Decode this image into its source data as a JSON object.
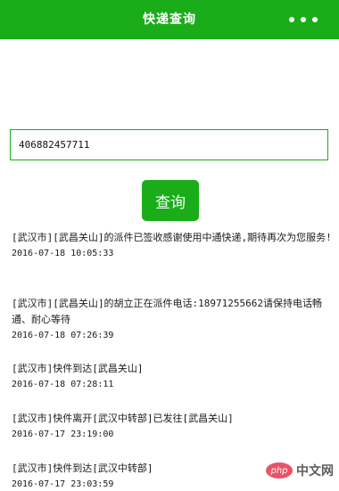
{
  "header": {
    "title": "快递查询",
    "menu_icon": "more-dots-icon",
    "color": "#1aad19"
  },
  "search": {
    "value": "406882457711"
  },
  "query_button": {
    "label": "查询"
  },
  "results": [
    {
      "message": "[武汉市][武昌关山]的派件已签收感谢使用中通快递,期待再次为您服务!",
      "time": "2016-07-18 10:05:33"
    },
    {
      "message": "[武汉市][武昌关山]的胡立正在派件电话:18971255662请保持电话畅通、耐心等待",
      "time": "2016-07-18 07:26:39"
    },
    {
      "message": "[武汉市]快件到达[武昌关山]",
      "time": "2016-07-18 07:28:11"
    },
    {
      "message": "[武汉市]快件离开[武汉中转部]已发往[武昌关山]",
      "time": "2016-07-17 23:19:00"
    },
    {
      "message": "[武汉市]快件到达[武汉中转部]",
      "time": "2016-07-17 23:03:59"
    }
  ],
  "watermark": {
    "logo_text": "php",
    "text": "中文网"
  }
}
